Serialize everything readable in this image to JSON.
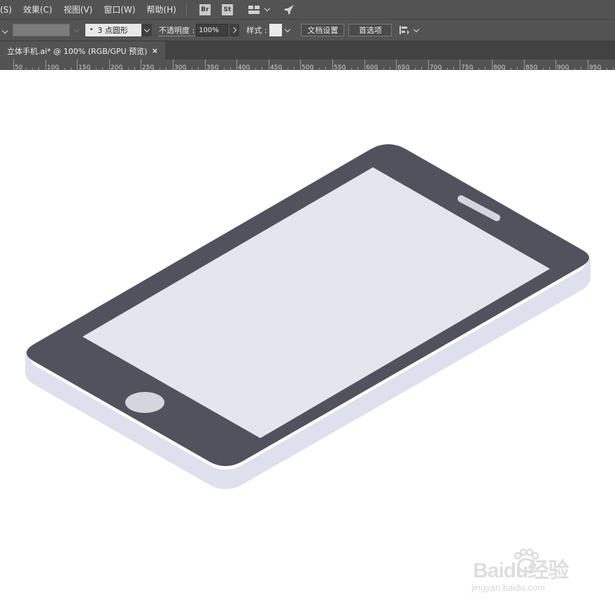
{
  "menubar": {
    "items": [
      "(S)",
      "效果(C)",
      "视图(V)",
      "窗口(W)",
      "帮助(H)"
    ],
    "bridge_badge": "Br",
    "stock_badge": "St"
  },
  "controlbar": {
    "brush_value": "3 点圆形",
    "opacity_label": "不透明度 :",
    "opacity_value": "100%",
    "style_label": "样式 :",
    "doc_setup_button": "文档设置",
    "preferences_button": "首选项"
  },
  "tab": {
    "title": "立体手机.ai* @ 100% (RGB/GPU 预览)",
    "close": "×"
  },
  "ruler": {
    "labels": [
      "50",
      "100",
      "150",
      "200",
      "250",
      "300",
      "350",
      "400",
      "450",
      "500",
      "550",
      "600",
      "650",
      "700",
      "750",
      "800",
      "850",
      "900",
      "950"
    ]
  },
  "artwork": {
    "body_color": "#52525f",
    "screen_color": "#e4e6ee",
    "side_color": "#dfe0ee",
    "button_color": "#d4d6de",
    "speaker_color": "#d4d6de"
  },
  "watermark": {
    "brand": "Baidu经验",
    "url": "jingyan.baidu.com"
  }
}
